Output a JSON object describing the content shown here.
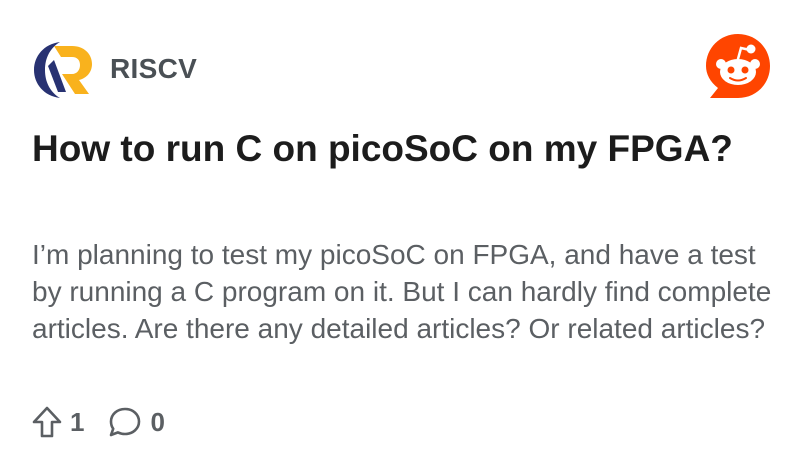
{
  "community": {
    "name": "RISCV",
    "logo_icon": "riscv-logo",
    "colors": {
      "navy": "#283272",
      "gold": "#f9b21d"
    }
  },
  "brand": {
    "icon": "reddit-icon",
    "color": "#ff4500"
  },
  "post": {
    "title": "How to run C on picoSoC on my FPGA?",
    "body": "I’m planning to test my picoSoC on FPGA, and have a test by running a C program on it. But I can hardly find complete articles. Are there any detailed articles? Or related articles?"
  },
  "actions": {
    "upvote": {
      "icon": "upvote-arrow-icon",
      "count": "1"
    },
    "comments": {
      "icon": "comment-bubble-icon",
      "count": "0"
    }
  }
}
